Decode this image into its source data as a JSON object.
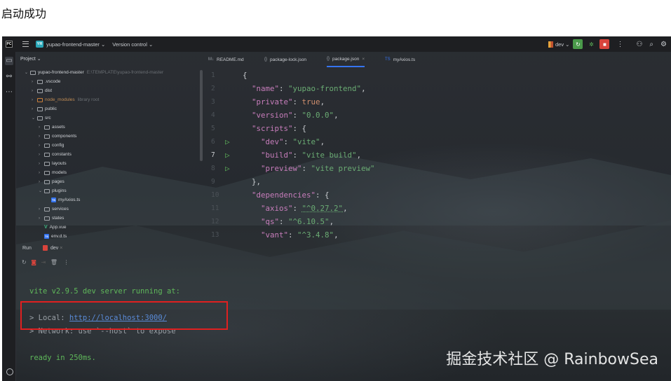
{
  "heading": "启动成功",
  "titlebar": {
    "project_badge": "YR",
    "project_name": "yupao-frontend-master",
    "version_control": "Version control",
    "branch": "dev"
  },
  "project_panel": {
    "header": "Project",
    "tree": [
      {
        "label": "yupao-frontend-master",
        "note": "E:\\TEMPLATE\\yupao-frontend-master",
        "kind": "folder",
        "depth": 0,
        "open": true
      },
      {
        "label": ".vscode",
        "kind": "folder",
        "depth": 1
      },
      {
        "label": "dist",
        "kind": "folder",
        "depth": 1
      },
      {
        "label": "node_modules",
        "note": "library root",
        "kind": "nm",
        "depth": 1
      },
      {
        "label": "public",
        "kind": "folder",
        "depth": 1
      },
      {
        "label": "src",
        "kind": "folder",
        "depth": 1,
        "open": true
      },
      {
        "label": "assets",
        "kind": "folder",
        "depth": 2
      },
      {
        "label": "components",
        "kind": "folder",
        "depth": 2
      },
      {
        "label": "config",
        "kind": "folder",
        "depth": 2
      },
      {
        "label": "constants",
        "kind": "folder",
        "depth": 2
      },
      {
        "label": "layouts",
        "kind": "folder",
        "depth": 2
      },
      {
        "label": "models",
        "kind": "folder",
        "depth": 2
      },
      {
        "label": "pages",
        "kind": "folder",
        "depth": 2
      },
      {
        "label": "plugins",
        "kind": "folder",
        "depth": 2,
        "open": true
      },
      {
        "label": "myAxios.ts",
        "kind": "ts",
        "depth": 3
      },
      {
        "label": "services",
        "kind": "folder",
        "depth": 2
      },
      {
        "label": "states",
        "kind": "folder",
        "depth": 2
      },
      {
        "label": "App.vue",
        "kind": "vue",
        "depth": 2
      },
      {
        "label": "env.d.ts",
        "kind": "ts",
        "depth": 2
      }
    ]
  },
  "tabs": [
    {
      "label": "README.md",
      "icon": "M↓",
      "active": false
    },
    {
      "label": "package-lock.json",
      "icon": "{}",
      "active": false
    },
    {
      "label": "package.json",
      "icon": "{}",
      "active": true
    },
    {
      "label": "myAxios.ts",
      "icon": "TS",
      "active": false
    }
  ],
  "editor_lines": [
    {
      "n": "1",
      "html": "{"
    },
    {
      "n": "2",
      "html": "  <span class='k'>\"name\"</span>: <span class='s'>\"yupao-frontend\"</span>,"
    },
    {
      "n": "3",
      "html": "  <span class='k'>\"private\"</span>: <span class='kw'>true</span>,"
    },
    {
      "n": "4",
      "html": "  <span class='k'>\"version\"</span>: <span class='s'>\"0.0.0\"</span>,"
    },
    {
      "n": "5",
      "html": "  <span class='k'>\"scripts\"</span>: {"
    },
    {
      "n": "6",
      "run": true,
      "html": "    <span class='k'>\"dev\"</span>: <span class='s'>\"vite\"</span>,"
    },
    {
      "n": "7",
      "run": true,
      "active": true,
      "html": "    <span class='k'>\"build\"</span>: <span class='s'>\"vite build\"</span>,"
    },
    {
      "n": "8",
      "run": true,
      "html": "    <span class='k'>\"preview\"</span>: <span class='s'>\"vite preview\"</span>"
    },
    {
      "n": "9",
      "html": "  },"
    },
    {
      "n": "10",
      "html": "  <span class='k'>\"dependencies\"</span>: {"
    },
    {
      "n": "11",
      "html": "    <span class='k'>\"axios\"</span>: <span class='s u'>\"^0.27.2\"</span>,"
    },
    {
      "n": "12",
      "html": "    <span class='k'>\"qs\"</span>: <span class='s'>\"^6.10.5\"</span>,"
    },
    {
      "n": "13",
      "html": "    <span class='k'>\"vant\"</span>: <span class='s'>\"^3.4.8\"</span>,"
    }
  ],
  "run_panel": {
    "run_label": "Run",
    "config": "dev"
  },
  "console": {
    "line1": "vite v2.9.5 dev server running at:",
    "local_prefix": "> Local: ",
    "local_url": "http://localhost:3000/",
    "network": "> Network: use `--host` to expose",
    "ready": "ready in 250ms."
  },
  "watermark": "掘金技术社区 @ RainbowSea"
}
